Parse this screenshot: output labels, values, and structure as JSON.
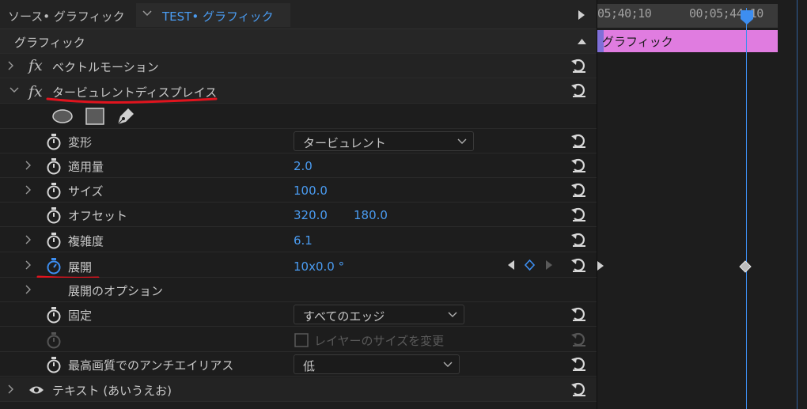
{
  "header": {
    "source_label": "ソース• グラフィック",
    "sequence_label": "TEST• グラフィック"
  },
  "section": {
    "title": "グラフィック"
  },
  "effects": {
    "vector_motion": "ベクトルモーション",
    "turbulent_displace": "タービュレントディスプレイス"
  },
  "params": {
    "deform": {
      "label": "変形",
      "value": "タービュレント"
    },
    "amount": {
      "label": "適用量",
      "value": "2.0"
    },
    "size": {
      "label": "サイズ",
      "value": "100.0"
    },
    "offset": {
      "label": "オフセット",
      "x": "320.0",
      "y": "180.0"
    },
    "complexity": {
      "label": "複雑度",
      "value": "6.1"
    },
    "evolution": {
      "label": "展開",
      "value": "10x0.0 °"
    },
    "evolution_options": {
      "label": "展開のオプション"
    },
    "pinning": {
      "label": "固定",
      "value": "すべてのエッジ"
    },
    "resize_layer": {
      "label": "レイヤーのサイズを変更"
    },
    "antialias": {
      "label": "最高画質でのアンチエイリアス",
      "value": "低"
    }
  },
  "text_layer": {
    "label": "テキスト (あいうえお)"
  },
  "timeline": {
    "timecode_start": "05;40;10",
    "timecode_end": "00;05;44;10",
    "clip_label": "グラフィック"
  },
  "colors": {
    "accent": "#4a9cf2",
    "clip": "#e07ce0",
    "annotation": "#e0141e"
  }
}
